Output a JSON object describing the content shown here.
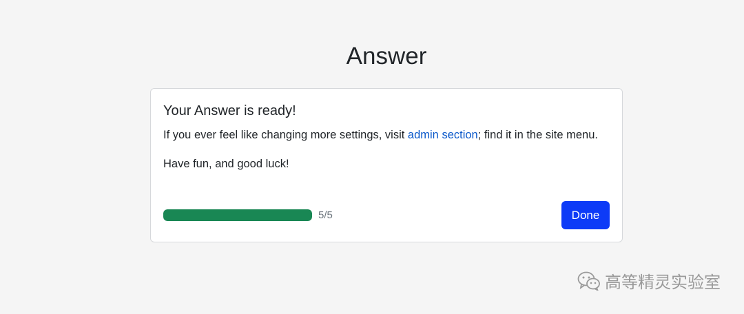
{
  "page": {
    "title": "Answer"
  },
  "card": {
    "title": "Your Answer is ready!",
    "text_before_link": "If you ever feel like changing more settings, visit ",
    "link_text": "admin section",
    "text_after_link": "; find it in the site menu.",
    "fun_text": "Have fun, and good luck!"
  },
  "progress": {
    "label": "5/5",
    "value": 5,
    "max": 5
  },
  "buttons": {
    "done_label": "Done"
  },
  "watermark": {
    "text": "高等精灵实验室",
    "icon": "wechat-icon"
  },
  "colors": {
    "progress_fill": "#198754",
    "button": "#0d3bf7",
    "link": "#0a58ca"
  }
}
